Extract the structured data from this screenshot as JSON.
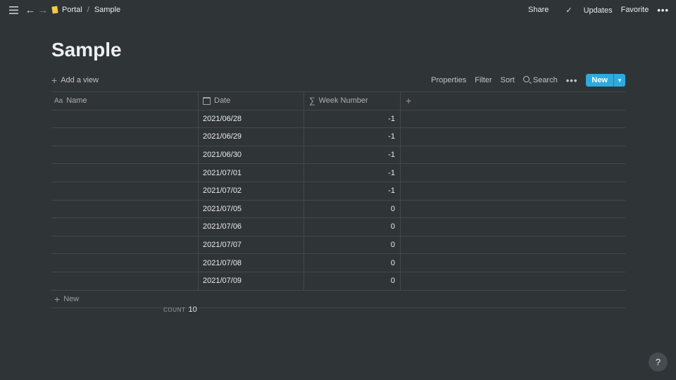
{
  "breadcrumb": {
    "workspace": "Portal",
    "page": "Sample",
    "separator": "/"
  },
  "topbar": {
    "share": "Share",
    "updates": "Updates",
    "favorite": "Favorite",
    "more": "•••"
  },
  "page_title": "Sample",
  "viewbar": {
    "add_view": "Add a view",
    "properties": "Properties",
    "filter": "Filter",
    "sort": "Sort",
    "search": "Search",
    "more": "•••",
    "new": "New"
  },
  "table": {
    "columns": {
      "name": "Name",
      "date": "Date",
      "week": "Week Number"
    },
    "rows": [
      {
        "name": "",
        "date": "2021/06/28",
        "week": "-1"
      },
      {
        "name": "",
        "date": "2021/06/29",
        "week": "-1"
      },
      {
        "name": "",
        "date": "2021/06/30",
        "week": "-1"
      },
      {
        "name": "",
        "date": "2021/07/01",
        "week": "-1"
      },
      {
        "name": "",
        "date": "2021/07/02",
        "week": "-1"
      },
      {
        "name": "",
        "date": "2021/07/05",
        "week": "0"
      },
      {
        "name": "",
        "date": "2021/07/06",
        "week": "0"
      },
      {
        "name": "",
        "date": "2021/07/07",
        "week": "0"
      },
      {
        "name": "",
        "date": "2021/07/08",
        "week": "0"
      },
      {
        "name": "",
        "date": "2021/07/09",
        "week": "0"
      }
    ],
    "new_row": "New"
  },
  "footer": {
    "count_label": "COUNT",
    "count_value": "10"
  },
  "help": "?",
  "colors": {
    "background": "#2f3437",
    "accent": "#2eaadc"
  }
}
